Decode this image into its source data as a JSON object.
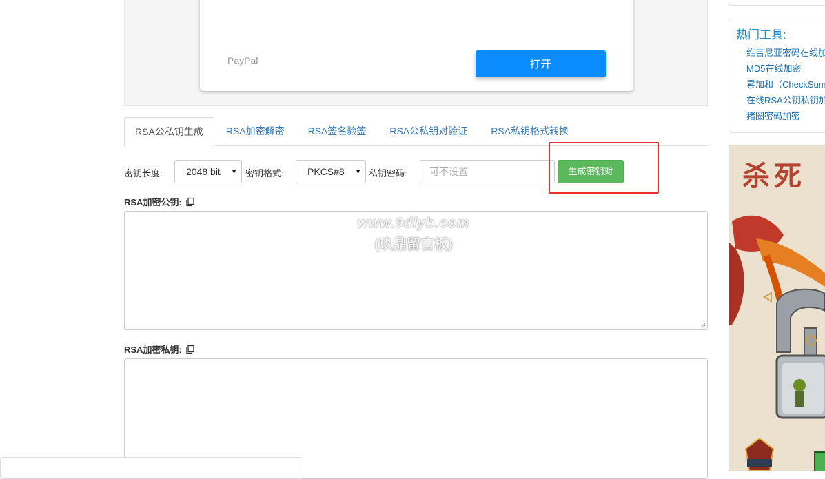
{
  "ad": {
    "paypal_label": "PayPal",
    "open_button": "打开"
  },
  "tabs": [
    {
      "label": "RSA公私钥生成",
      "active": true
    },
    {
      "label": "RSA加密解密",
      "active": false
    },
    {
      "label": "RSA签名验签",
      "active": false
    },
    {
      "label": "RSA公私钥对验证",
      "active": false
    },
    {
      "label": "RSA私钥格式转换",
      "active": false
    }
  ],
  "form": {
    "key_length_label": "密钥长度:",
    "key_length_value": "2048 bit",
    "key_format_label": "密钥格式:",
    "key_format_value": "PKCS#8",
    "private_password_label": "私钥密码:",
    "private_password_placeholder": "可不设置",
    "generate_button": "生成密钥对"
  },
  "public_key": {
    "label": "RSA加密公钥:",
    "value": ""
  },
  "private_key": {
    "label": "RSA加密私钥:",
    "value": ""
  },
  "watermark": {
    "line1": "www.9dlyb.com",
    "line2": "(玖鼎留言板)"
  },
  "sidebar": {
    "hot_tools_title": "热门工具:",
    "hot_tools": [
      "维吉尼亚密码在线加",
      "MD5在线加密",
      "累加和（CheckSum",
      "在线RSA公钥私钥加",
      "猪圈密码加密"
    ],
    "game_ad_text": "杀死"
  },
  "colors": {
    "tab_link": "#337ab7",
    "generate_button": "#5cb85c",
    "open_button": "#0a8cff",
    "highlight_box": "#e53030",
    "hot_title": "#1a8ccf"
  }
}
